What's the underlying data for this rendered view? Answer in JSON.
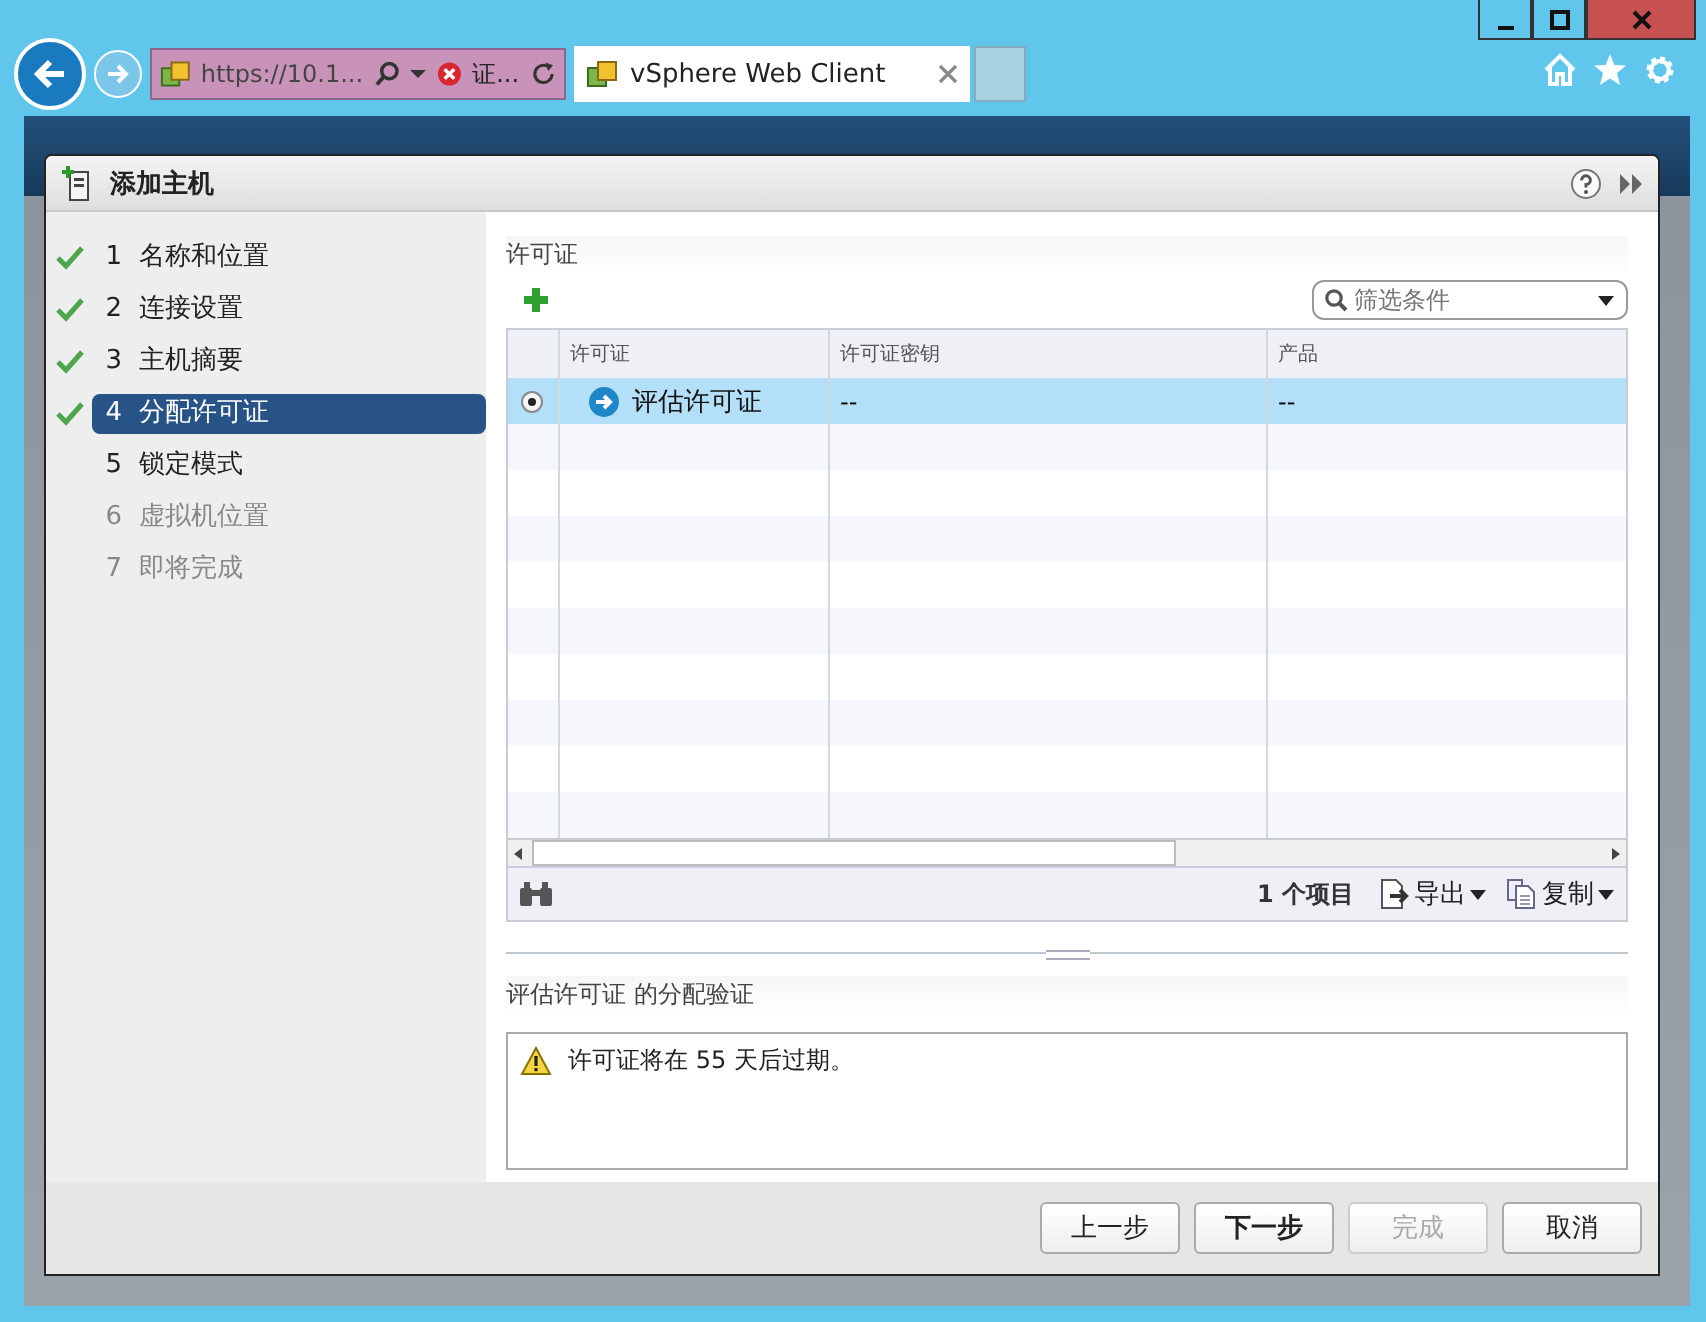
{
  "browser": {
    "address": "https://10.1...",
    "cert_error": "证...",
    "tabs": [
      {
        "label": "vSphere Web Client",
        "selected": true
      }
    ]
  },
  "dialog": {
    "title": "添加主机",
    "steps": [
      {
        "number": "1",
        "label": "名称和位置",
        "done": true,
        "selected": false,
        "disabled": false
      },
      {
        "number": "2",
        "label": "连接设置",
        "done": true,
        "selected": false,
        "disabled": false
      },
      {
        "number": "3",
        "label": "主机摘要",
        "done": true,
        "selected": false,
        "disabled": false
      },
      {
        "number": "4",
        "label": "分配许可证",
        "done": true,
        "selected": true,
        "disabled": false
      },
      {
        "number": "5",
        "label": "锁定模式",
        "done": false,
        "selected": false,
        "disabled": false
      },
      {
        "number": "6",
        "label": "虚拟机位置",
        "done": false,
        "selected": false,
        "disabled": true
      },
      {
        "number": "7",
        "label": "即将完成",
        "done": false,
        "selected": false,
        "disabled": true
      }
    ],
    "section_title": "许可证",
    "filter": {
      "placeholder": "筛选条件"
    },
    "table": {
      "columns": [
        "许可证",
        "许可证密钥",
        "产品"
      ],
      "rows": [
        {
          "selected": true,
          "cells": [
            "评估许可证",
            "--",
            "--"
          ]
        }
      ]
    },
    "item_count": "1 个项目",
    "export_label": "导出",
    "copy_label": "复制",
    "validation_title": "评估许可证 的分配验证",
    "validation_messages": [
      {
        "kind": "warning",
        "text": "许可证将在 55 天后过期。"
      }
    ],
    "buttons": [
      {
        "label": "上一步",
        "default": false,
        "disabled": false
      },
      {
        "label": "下一步",
        "default": true,
        "disabled": false
      },
      {
        "label": "完成",
        "default": false,
        "disabled": true
      },
      {
        "label": "取消",
        "default": false,
        "disabled": false
      }
    ]
  }
}
